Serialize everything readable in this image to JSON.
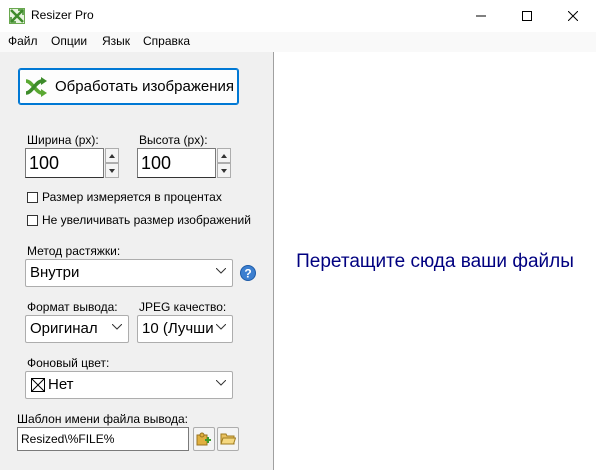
{
  "window": {
    "title": "Resizer Pro"
  },
  "menu": {
    "items": [
      "Файл",
      "Опции",
      "Язык",
      "Справка"
    ]
  },
  "process_button": {
    "label": "Обработать изображения"
  },
  "width": {
    "label": "Ширина (px):",
    "value": "100"
  },
  "height": {
    "label": "Высота (px):",
    "value": "100"
  },
  "checkboxes": [
    {
      "label": "Размер измеряется в процентах",
      "checked": false
    },
    {
      "label": "Не увеличивать размер изображений",
      "checked": false
    }
  ],
  "stretch": {
    "label": "Метод растяжки:",
    "value": "Внутри"
  },
  "output_format": {
    "label": "Формат вывода:",
    "value": "Оригинал"
  },
  "jpeg_quality": {
    "label": "JPEG качество:",
    "value": "10 (Лучши"
  },
  "background": {
    "label": "Фоновый цвет:",
    "value": "Нет"
  },
  "template": {
    "label": "Шаблон имени файла вывода:",
    "value": "Resized\\%FILE%"
  },
  "drop_zone": {
    "text": "Перетащите сюда ваши файлы",
    "color": "#000080"
  },
  "accent_color": "#0078d4"
}
